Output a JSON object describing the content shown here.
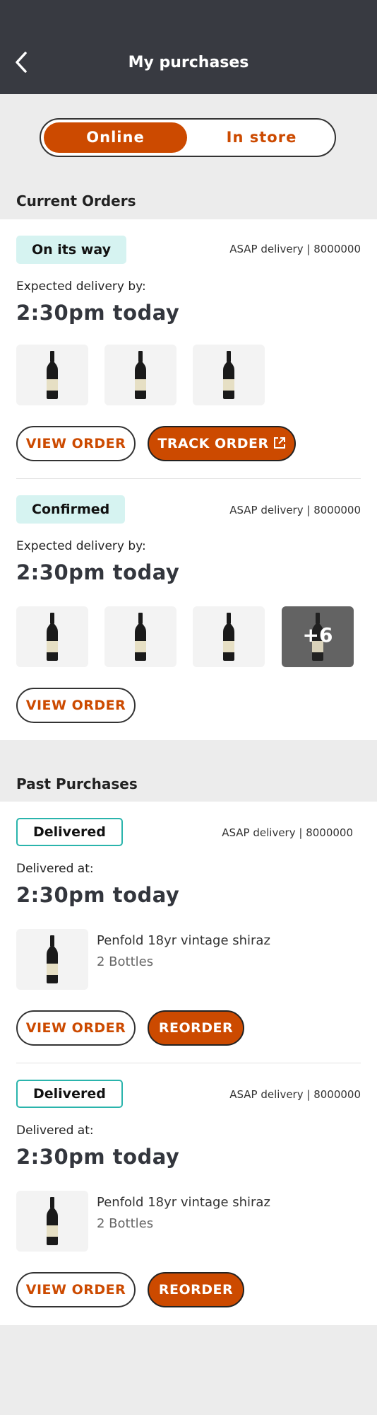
{
  "header": {
    "title": "My purchases",
    "back_icon": "chevron-left-icon"
  },
  "tabs": {
    "online": "Online",
    "in_store": "In store",
    "active": "Online"
  },
  "current": {
    "title": "Current Orders",
    "orders": [
      {
        "status": "On its way",
        "delivery": "ASAP delivery | 8000000",
        "expected_label": "Expected delivery by:",
        "time": "2:30pm today",
        "view_label": "VIEW ORDER",
        "track_label": "TRACK ORDER"
      },
      {
        "status": "Confirmed",
        "delivery": "ASAP delivery | 8000000",
        "expected_label": "Expected delivery by:",
        "time": "2:30pm today",
        "more_count": "+6",
        "view_label": "VIEW ORDER"
      }
    ]
  },
  "past": {
    "title": "Past Purchases",
    "orders": [
      {
        "status": "Delivered",
        "delivery": "ASAP delivery | 8000000",
        "delivered_label": "Delivered at:",
        "time": "2:30pm today",
        "product": "Penfold 18yr vintage shiraz",
        "qty": "2 Bottles",
        "view_label": "VIEW ORDER",
        "reorder_label": "REORDER"
      },
      {
        "status": "Delivered",
        "delivery": "ASAP delivery |  8000000",
        "delivered_label": "Delivered at:",
        "time": "2:30pm today",
        "product": "Penfold 18yr vintage shiraz",
        "qty": "2 Bottles",
        "view_label": "VIEW ORDER",
        "reorder_label": "REORDER"
      }
    ]
  },
  "colors": {
    "accent": "#cc4a00",
    "header_bg": "#383a41",
    "badge_teal": "#2ab4ac",
    "badge_light": "#d6f3f1"
  }
}
